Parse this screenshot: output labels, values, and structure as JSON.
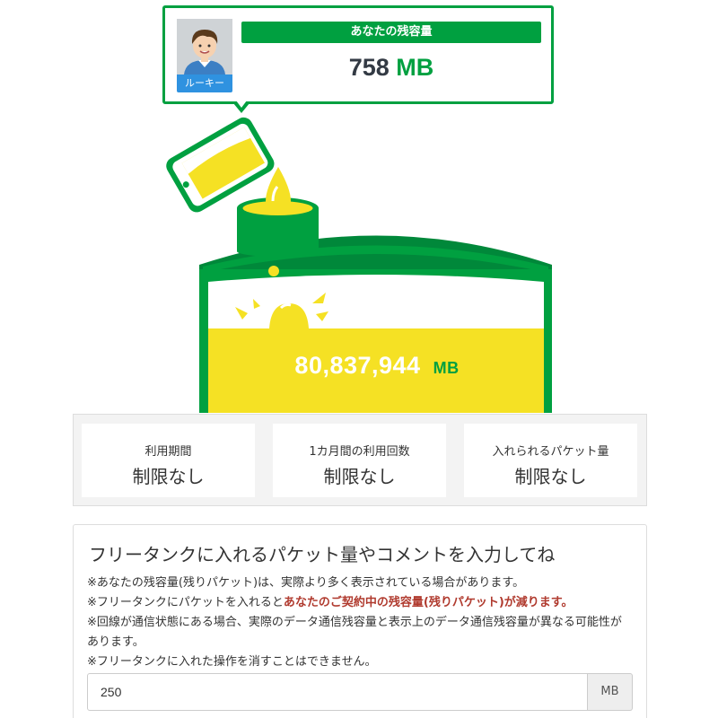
{
  "user": {
    "rank": "ルーキー",
    "balance_heading": "あなたの残容量",
    "balance_value": "758",
    "balance_unit": "MB"
  },
  "tank": {
    "total_value": "80,837,944",
    "total_unit": "MB"
  },
  "limits": [
    {
      "label": "利用期間",
      "value": "制限なし"
    },
    {
      "label": "1カ月間の利用回数",
      "value": "制限なし"
    },
    {
      "label": "入れられるパケット量",
      "value": "制限なし"
    }
  ],
  "form": {
    "title": "フリータンクに入れるパケット量やコメントを入力してね",
    "note1": "※あなたの残容量(残りパケット)は、実際より多く表示されている場合があります。",
    "note2_prefix": "※フリータンクにパケットを入れると",
    "note2_warning": "あなたのご契約中の残容量(残りパケット)が減ります。",
    "note3": "※回線が通信状態にある場合、実際のデータ通信残容量と表示上のデータ通信残容量が異なる可能性があります。",
    "note4": "※フリータンクに入れた操作を消すことはできません。",
    "amount_value": "250",
    "amount_unit": "MB"
  },
  "colors": {
    "brand_green": "#00a040",
    "tank_yellow": "#f5e124",
    "rank_blue": "#2f92e0",
    "warning_red": "#b03a2e"
  }
}
